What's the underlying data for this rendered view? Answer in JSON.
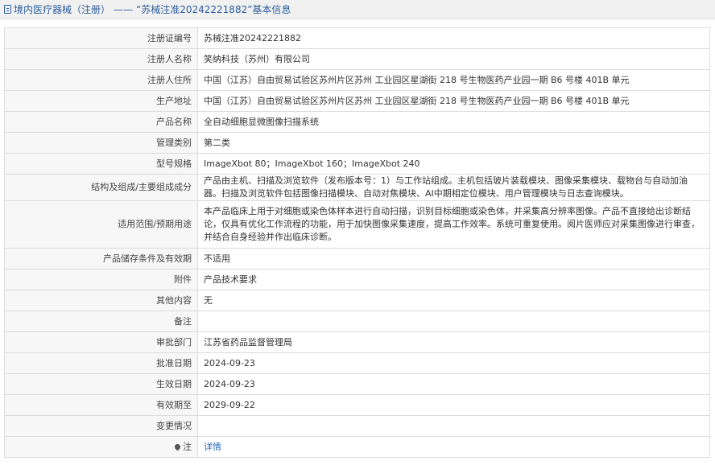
{
  "header": {
    "category": "境内医疗器械（注册）",
    "separator": "——",
    "record": "“苏械注准20242221882”基本信息"
  },
  "rows": [
    {
      "label": "注册证编号",
      "value": "苏械注准20242221882"
    },
    {
      "label": "注册人名称",
      "value": "笑纳科技（苏州）有限公司"
    },
    {
      "label": "注册人住所",
      "value": "中国（江苏）自由贸易试验区苏州片区苏州 工业园区星湖街 218 号生物医药产业园一期 B6 号楼 401B 单元"
    },
    {
      "label": "生产地址",
      "value": "中国（江苏）自由贸易试验区苏州片区苏州 工业园区星湖街 218 号生物医药产业园一期 B6 号楼 401B 单元"
    },
    {
      "label": "产品名称",
      "value": "全自动细胞显微图像扫描系统"
    },
    {
      "label": "管理类别",
      "value": "第二类"
    },
    {
      "label": "型号规格",
      "value": "ImageXbot 80；ImageXbot 160；ImageXbot 240"
    },
    {
      "label": "结构及组成/主要组成成分",
      "value": "产品由主机、扫描及浏览软件（发布版本号：1）与工作站组成。主机包括玻片装载模块、图像采集模块、载物台与自动加油器。扫描及浏览软件包括图像扫描模块、自动对焦模块、AI中期相定位模块、用户管理模块与日志查询模块。"
    },
    {
      "label": "适用范围/预期用途",
      "value": "本产品临床上用于对细胞或染色体样本进行自动扫描，识别目标细胞或染色体，并采集高分辨率图像。产品不直接给出诊断结论，仅具有优化工作流程的功能，用于加快图像采集速度，提高工作效率。系统可重复使用。阅片医师应对采集图像进行审查，并结合自身经验并作出临床诊断。"
    },
    {
      "label": "产品储存条件及有效期",
      "value": "不适用"
    },
    {
      "label": "附件",
      "value": "产品技术要求"
    },
    {
      "label": "其他内容",
      "value": "无"
    },
    {
      "label": "备注",
      "value": ""
    },
    {
      "label": "审批部门",
      "value": "江苏省药品监督管理局"
    },
    {
      "label": "批准日期",
      "value": "2024-09-23"
    },
    {
      "label": "生效日期",
      "value": "2024-09-23"
    },
    {
      "label": "有效期至",
      "value": "2029-09-22"
    },
    {
      "label": "变更情况",
      "value": ""
    }
  ],
  "note_row": {
    "label": "注",
    "link": "详情"
  }
}
